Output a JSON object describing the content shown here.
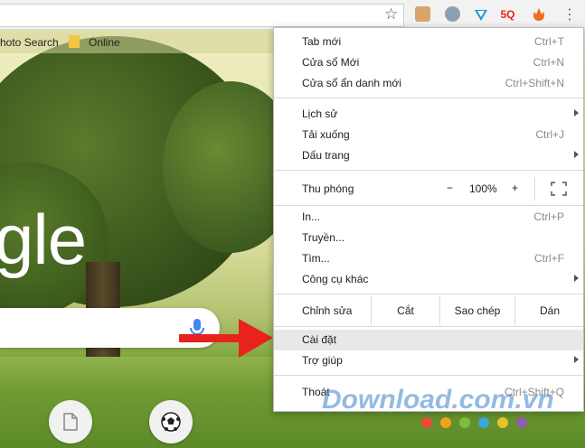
{
  "bookmarks": {
    "item1": "hoto Search",
    "item2": "Online"
  },
  "background": {
    "logo_text": "gle"
  },
  "extensions": [
    "tab-ext-icon",
    "plugin-icon",
    "vpn-icon",
    "sq-icon",
    "fox-icon"
  ],
  "extension_badge": "5Q",
  "menu": {
    "new_tab": {
      "label": "Tab mới",
      "shortcut": "Ctrl+T"
    },
    "new_window": {
      "label": "Cửa sổ Mới",
      "shortcut": "Ctrl+N"
    },
    "incognito": {
      "label": "Cửa sổ ẩn danh mới",
      "shortcut": "Ctrl+Shift+N"
    },
    "history": {
      "label": "Lịch sử"
    },
    "downloads": {
      "label": "Tải xuống",
      "shortcut": "Ctrl+J"
    },
    "bookmarks": {
      "label": "Dấu trang"
    },
    "zoom": {
      "label": "Thu phóng",
      "minus": "−",
      "value": "100%",
      "plus": "+"
    },
    "print": {
      "label": "In...",
      "shortcut": "Ctrl+P"
    },
    "cast": {
      "label": "Truyền..."
    },
    "find": {
      "label": "Tìm...",
      "shortcut": "Ctrl+F"
    },
    "more_tools": {
      "label": "Công cụ khác"
    },
    "edit": {
      "label": "Chỉnh sửa",
      "cut": "Cắt",
      "copy": "Sao chép",
      "paste": "Dán"
    },
    "settings": {
      "label": "Cài đặt"
    },
    "help": {
      "label": "Trợ giúp"
    },
    "exit": {
      "label": "Thoát",
      "shortcut": "Ctrl+Shift+Q"
    }
  },
  "watermark": "Download.com.vn",
  "colors": {
    "accent_red": "#e8231e",
    "menu_highlight": "#e8e8e8",
    "watermark_dots": [
      "#e84b3a",
      "#f2a31c",
      "#7bbd43",
      "#39a7dd",
      "#e8c226",
      "#8e5db0"
    ]
  }
}
